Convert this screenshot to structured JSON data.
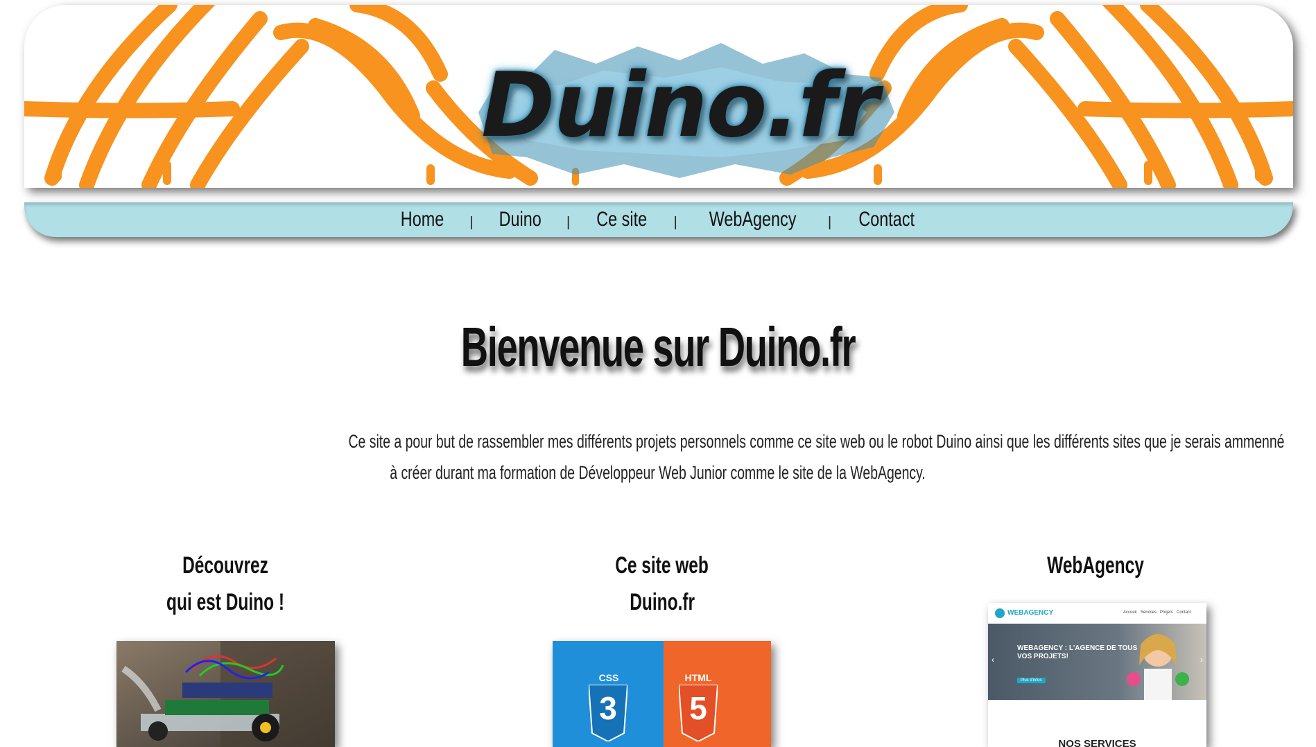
{
  "banner": {
    "logo_text": "Duino.fr"
  },
  "nav": {
    "items": [
      {
        "label": "Home"
      },
      {
        "label": "Duino"
      },
      {
        "label": "Ce site"
      },
      {
        "label": "WebAgency"
      },
      {
        "label": "Contact"
      }
    ],
    "separator": "|"
  },
  "main": {
    "title": "Bienvenue sur Duino.fr",
    "intro_line1": "Ce site a pour but de rassembler mes différents projets personnels comme ce site web ou le robot Duino ainsi que les différents sites que je serais ammenné",
    "intro_line2": "à créer durant ma formation de Développeur Web Junior comme le site de la WebAgency."
  },
  "cards": [
    {
      "title_line1": "Découvrez",
      "title_line2": "qui est Duino !"
    },
    {
      "title_line1": "Ce site web",
      "title_line2": "Duino.fr",
      "css_label": "CSS",
      "css_number": "3",
      "html_label": "HTML",
      "html_number": "5"
    },
    {
      "title_line1": "WebAgency",
      "title_line2": "",
      "preview": {
        "brand": "WEBAGENCY",
        "menu": [
          "Accueil",
          "Services",
          "Projets",
          "Contact"
        ],
        "headline_1": "WEBAGENCY : L'AGENCE DE TOUS",
        "headline_2": "VOS PROJETS!",
        "button": "Plus d'infos",
        "section_title": "NOS SERVICES"
      }
    }
  ],
  "colors": {
    "nav_bg": "#b0dfe5",
    "banner_orange": "#f7931e",
    "css_blue": "#1f8fd9",
    "html_orange": "#f06529"
  }
}
